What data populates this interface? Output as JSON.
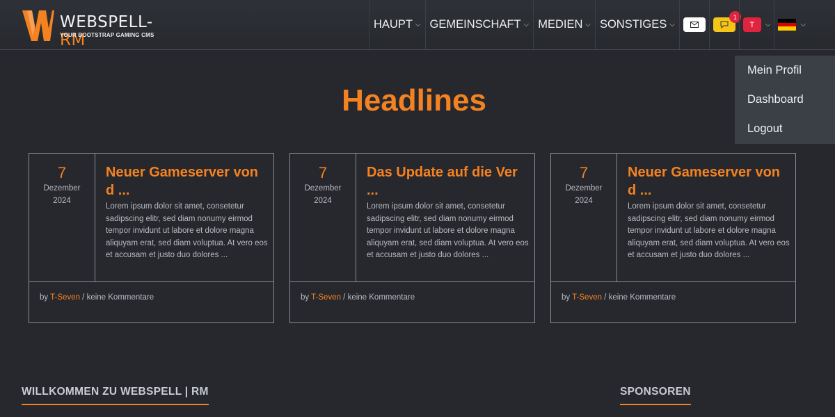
{
  "brand": {
    "name_main": "WEBSPELL-",
    "name_accent": "RM",
    "tagline": "YOUR BOOTSTRAP GAMING CMS"
  },
  "nav": {
    "items": [
      {
        "label": "HAUPT"
      },
      {
        "label": "GEMEINSCHAFT"
      },
      {
        "label": "MEDIEN"
      },
      {
        "label": "SONSTIGES"
      }
    ],
    "messages_badge": "1",
    "user_initial": "T"
  },
  "dropdown": {
    "items": [
      {
        "label": "Mein Profil"
      },
      {
        "label": "Dashboard"
      },
      {
        "label": "Logout"
      }
    ]
  },
  "headlines": {
    "title": "Headlines",
    "cards": [
      {
        "day": "7",
        "month": "Dezember",
        "year": "2024",
        "title": "Neuer Gameserver von d ...",
        "excerpt": "Lorem ipsum dolor sit amet, consetetur sadipscing elitr, sed diam nonumy eirmod tempor invidunt ut labore et dolore magna aliquyam erat, sed diam voluptua. At vero eos et accusam et justo duo dolores ...",
        "by": "by",
        "author": "T-Seven",
        "comments": " / keine Kommentare"
      },
      {
        "day": "7",
        "month": "Dezember",
        "year": "2024",
        "title": "Das Update auf die Ver ...",
        "excerpt": "Lorem ipsum dolor sit amet, consetetur sadipscing elitr, sed diam nonumy eirmod tempor invidunt ut labore et dolore magna aliquyam erat, sed diam voluptua. At vero eos et accusam et justo duo dolores ...",
        "by": "by",
        "author": "T-Seven",
        "comments": " / keine Kommentare"
      },
      {
        "day": "7",
        "month": "Dezember",
        "year": "2024",
        "title": "Neuer Gameserver von d ...",
        "excerpt": "Lorem ipsum dolor sit amet, consetetur sadipscing elitr, sed diam nonumy eirmod tempor invidunt ut labore et dolore magna aliquyam erat, sed diam voluptua. At vero eos et accusam et justo duo dolores ...",
        "by": "by",
        "author": "T-Seven",
        "comments": " / keine Kommentare"
      }
    ]
  },
  "sections": {
    "welcome": "WILLKOMMEN ZU WEBSPELL | RM",
    "sponsors": "SPONSOREN"
  },
  "icons": {
    "mail": "envelope-icon",
    "messages": "chat-bubble-icon",
    "language": "german-flag-icon",
    "chevron": "chevron-down-icon"
  },
  "colors": {
    "accent": "#f58220",
    "background": "#26282e",
    "navbar": "#2b2e33",
    "badge": "#e0243e",
    "messages_button": "#f5c518"
  }
}
